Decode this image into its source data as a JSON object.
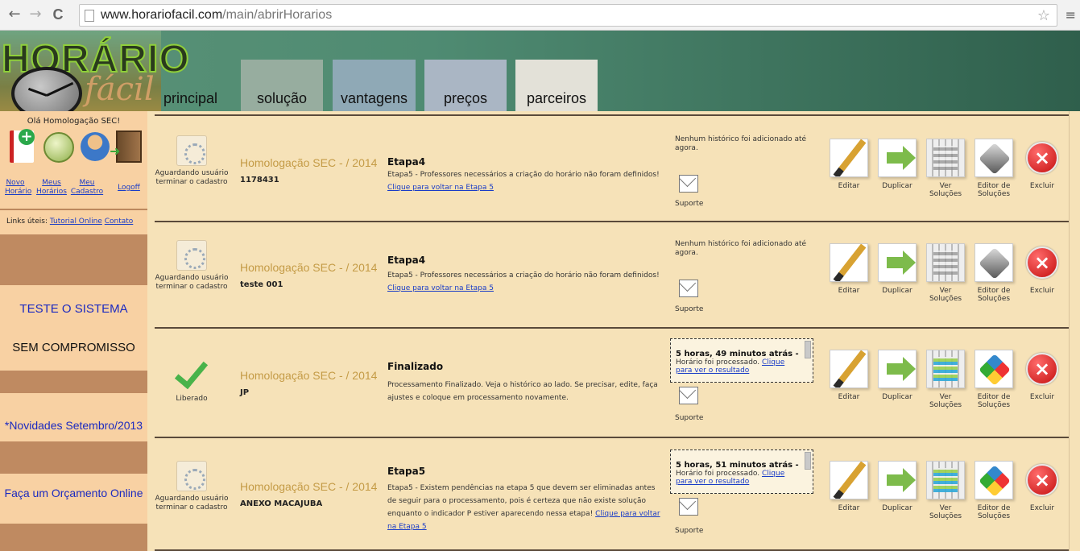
{
  "browser": {
    "back": "←",
    "forward": "→",
    "reload": "C",
    "url_host": "www.horariofacil.com",
    "url_path": "/main/abrirHorarios",
    "star": "☆",
    "menu": "≡"
  },
  "logo": {
    "title": "HORÁRIO",
    "subtitle": "fácil"
  },
  "nav_tabs": [
    {
      "label": "principal",
      "color": "transparent"
    },
    {
      "label": "solução",
      "color": "#97ad9f"
    },
    {
      "label": "vantagens",
      "color": "#8fa9b6"
    },
    {
      "label": "preços",
      "color": "#aab6c4"
    },
    {
      "label": "parceiros",
      "color": "#e3e1d8"
    }
  ],
  "sidebar": {
    "greeting": "Olá Homologação SEC!",
    "links": [
      {
        "line1": "Novo",
        "line2": "Horário"
      },
      {
        "line1": "Meus",
        "line2": "Horários"
      },
      {
        "line1": "Meu",
        "line2": "Cadastro"
      },
      {
        "line1": "",
        "line2": "Logoff"
      }
    ],
    "useful_label": "Links úteis:",
    "useful_links": [
      "Tutorial Online",
      "Contato"
    ],
    "promos": [
      "TESTE O SISTEMA",
      "SEM COMPROMISSO",
      "*Novidades Setembro/2013",
      "Faça um Orçamento Online"
    ]
  },
  "actions": [
    "Editar",
    "Duplicar",
    "Ver Soluções",
    "Editor de Soluções",
    "Excluir"
  ],
  "support_label": "Suporte",
  "rows": [
    {
      "status": "Aguardando usuário terminar o cadastro",
      "school": "Homologação SEC - / 2014",
      "code": "1178431",
      "etapa": "Etapa4",
      "desc": "Etapa5 - Professores necessários a criação do horário não foram definidos!",
      "link": "Clique para voltar na Etapa 5",
      "history": "Nenhum histórico foi adicionado até agora."
    },
    {
      "status": "Aguardando usuário terminar o cadastro",
      "school": "Homologação SEC - / 2014",
      "code": "teste 001",
      "etapa": "Etapa4",
      "desc": "Etapa5 - Professores necessários a criação do horário não foram definidos!",
      "link": "Clique para voltar na Etapa 5",
      "history": "Nenhum histórico foi adicionado até agora."
    },
    {
      "status": "Liberado",
      "school": "Homologação SEC - / 2014",
      "code": "JP",
      "etapa": "Finalizado",
      "desc": "Processamento Finalizado. Veja o histórico ao lado. Se precisar, edite, faça ajustes e coloque em processamento novamente.",
      "history_time": "5 horas, 49 minutos atrás -",
      "history_text": "Horário foi processado.",
      "history_link": "Clique para ver o resultado"
    },
    {
      "status": "Aguardando usuário terminar o cadastro",
      "school": "Homologação SEC - / 2014",
      "code": "ANEXO MACAJUBA",
      "etapa": "Etapa5",
      "desc": "Etapa5 - Existem pendências na etapa 5 que devem ser eliminadas antes de seguir para o processamento, pois é certeza que não existe solução enquanto o indicador P estiver aparecendo nessa etapa!",
      "link": "Clique para voltar na Etapa 5",
      "history_time": "5 horas, 51 minutos atrás -",
      "history_text": "Horário foi processado.",
      "history_link": "Clique para ver o resultado"
    }
  ]
}
